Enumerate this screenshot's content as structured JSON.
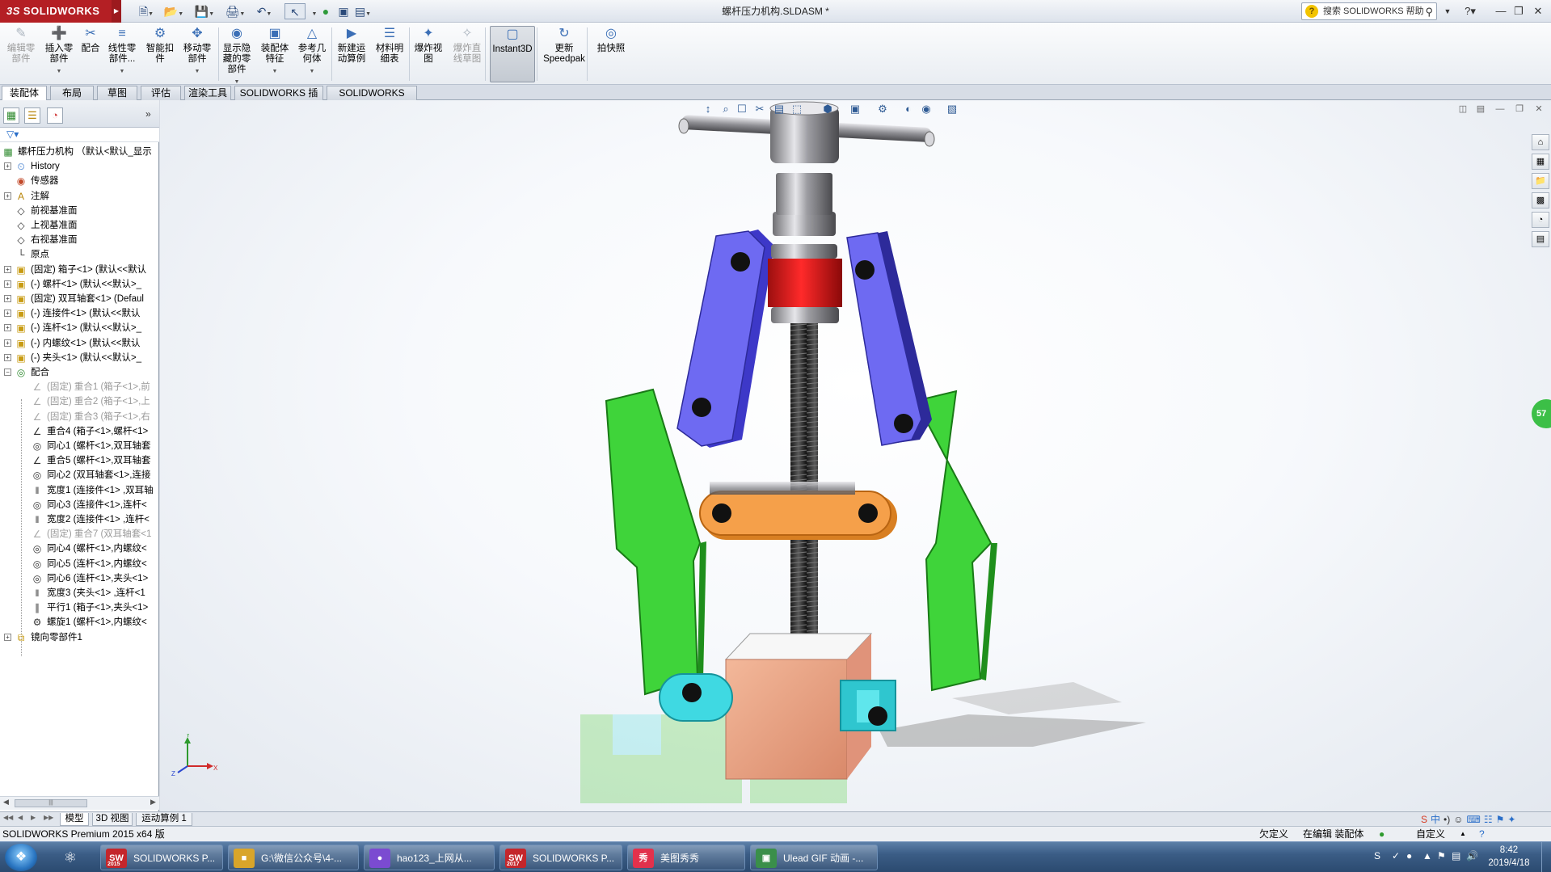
{
  "app": {
    "logo_ds": "3S",
    "logo_text": "SOLIDWORKS",
    "document_title": "螺杆压力机构.SLDASM *",
    "help_search_placeholder": "搜索 SOLIDWORKS 帮助"
  },
  "ribbon": {
    "buttons": [
      {
        "label": "编辑零\n部件",
        "icon": "edit-component-icon",
        "disabled": true
      },
      {
        "label": "插入零\n部件",
        "icon": "insert-component-icon"
      },
      {
        "label": "配合",
        "icon": "mate-icon"
      },
      {
        "label": "线性零\n部件...",
        "icon": "linear-pattern-icon"
      },
      {
        "label": "智能扣\n件",
        "icon": "smart-fasteners-icon"
      },
      {
        "label": "移动零\n部件",
        "icon": "move-component-icon"
      },
      {
        "label": "显示隐\n藏的零\n部件",
        "icon": "show-hidden-icon"
      },
      {
        "label": "装配体\n特征",
        "icon": "assembly-features-icon"
      },
      {
        "label": "参考几\n何体",
        "icon": "reference-geometry-icon"
      },
      {
        "label": "新建运\n动算例",
        "icon": "new-motion-study-icon"
      },
      {
        "label": "材料明\n细表",
        "icon": "bom-icon"
      },
      {
        "label": "爆炸视\n图",
        "icon": "exploded-view-icon"
      },
      {
        "label": "爆炸直\n线草图",
        "icon": "explode-line-sketch-icon",
        "disabled": true
      },
      {
        "label": "Instant3D",
        "icon": "instant3d-icon",
        "active": true
      },
      {
        "label": "更新\nSpeedpak",
        "icon": "speedpak-icon"
      },
      {
        "label": "拍快照",
        "icon": "snapshot-icon"
      }
    ]
  },
  "tabs": [
    "装配体",
    "布局",
    "草图",
    "评估",
    "渲染工具",
    "SOLIDWORKS 插件",
    "SOLIDWORKS MBD"
  ],
  "tree": {
    "root": "螺杆压力机构 （默认<默认_显示",
    "items": [
      {
        "label": "History",
        "icon": "history-icon",
        "exp": true
      },
      {
        "label": "传感器",
        "icon": "sensors-icon"
      },
      {
        "label": "注解",
        "icon": "annotations-icon",
        "exp": true
      },
      {
        "label": "前视基准面",
        "icon": "plane-icon"
      },
      {
        "label": "上视基准面",
        "icon": "plane-icon"
      },
      {
        "label": "右视基准面",
        "icon": "plane-icon"
      },
      {
        "label": "原点",
        "icon": "origin-icon"
      },
      {
        "label": "(固定) 箱子<1> (默认<<默认",
        "icon": "part-icon",
        "exp": true
      },
      {
        "label": "(-) 螺杆<1> (默认<<默认>_",
        "icon": "part-icon",
        "exp": true
      },
      {
        "label": "(固定) 双耳轴套<1> (Defaul",
        "icon": "part-icon",
        "exp": true
      },
      {
        "label": "(-) 连接件<1> (默认<<默认",
        "icon": "part-icon",
        "exp": true
      },
      {
        "label": "(-) 连杆<1> (默认<<默认>_",
        "icon": "part-icon",
        "exp": true
      },
      {
        "label": "(-) 内螺纹<1> (默认<<默认",
        "icon": "part-icon",
        "exp": true
      },
      {
        "label": "(-) 夹头<1> (默认<<默认>_",
        "icon": "part-icon",
        "exp": true
      },
      {
        "label": "配合",
        "icon": "mates-folder-icon",
        "exp": true,
        "open": true
      }
    ],
    "mates": [
      {
        "label": "(固定) 重合1 (箱子<1>,前",
        "icon": "coincident-icon",
        "grey": true
      },
      {
        "label": "(固定) 重合2 (箱子<1>,上",
        "icon": "coincident-icon",
        "grey": true
      },
      {
        "label": "(固定) 重合3 (箱子<1>,右",
        "icon": "coincident-icon",
        "grey": true
      },
      {
        "label": "重合4 (箱子<1>,螺杆<1>",
        "icon": "coincident-icon"
      },
      {
        "label": "同心1 (螺杆<1>,双耳轴套",
        "icon": "concentric-icon"
      },
      {
        "label": "重合5 (螺杆<1>,双耳轴套",
        "icon": "coincident-icon"
      },
      {
        "label": "同心2 (双耳轴套<1>,连接",
        "icon": "concentric-icon"
      },
      {
        "label": "宽度1 (连接件<1> ,双耳轴",
        "icon": "width-icon"
      },
      {
        "label": "同心3 (连接件<1>,连杆<",
        "icon": "concentric-icon"
      },
      {
        "label": "宽度2 (连接件<1> ,连杆<",
        "icon": "width-icon"
      },
      {
        "label": "(固定) 重合7 (双耳轴套<1",
        "icon": "coincident-icon",
        "grey": true
      },
      {
        "label": "同心4 (螺杆<1>,内螺纹<",
        "icon": "concentric-icon"
      },
      {
        "label": "同心5 (连杆<1>,内螺纹<",
        "icon": "concentric-icon"
      },
      {
        "label": "同心6 (连杆<1>,夹头<1>",
        "icon": "concentric-icon"
      },
      {
        "label": "宽度3 (夹头<1> ,连杆<1",
        "icon": "width-icon"
      },
      {
        "label": "平行1 (箱子<1>,夹头<1>",
        "icon": "parallel-icon"
      },
      {
        "label": "螺旋1 (螺杆<1>,内螺纹<",
        "icon": "screw-mate-icon"
      }
    ],
    "last": "镜向零部件1"
  },
  "bottom_tabs": [
    "模型",
    "3D 视图",
    "运动算例 1"
  ],
  "ime": [
    "S",
    "中",
    "•)",
    "☺",
    "⌨",
    "☷",
    "⚑",
    "✦"
  ],
  "status": {
    "app_version": "SOLIDWORKS Premium 2015 x64 版",
    "definition": "欠定义",
    "editing": "在编辑 装配体",
    "units": "自定义"
  },
  "badge": "57",
  "triad": {
    "x": "X",
    "y": "Y",
    "z": "Z"
  },
  "taskbar": {
    "tasks": [
      {
        "label": "SOLIDWORKS P...",
        "icon": "SW",
        "sub": "2015",
        "color": "#c4262b"
      },
      {
        "label": "G:\\微信公众号\\4-...",
        "icon": "■",
        "color": "#d9a52a"
      },
      {
        "label": "hao123_上网从...",
        "icon": "●",
        "color": "#7b4bd1"
      },
      {
        "label": "SOLIDWORKS P...",
        "icon": "SW",
        "sub": "2017",
        "color": "#c4262b"
      },
      {
        "label": "美图秀秀",
        "icon": "秀",
        "color": "#e2314c"
      },
      {
        "label": "Ulead GIF 动画 -...",
        "icon": "▣",
        "color": "#3a8f4a"
      }
    ],
    "time": "8:42",
    "date": "2019/4/18"
  }
}
